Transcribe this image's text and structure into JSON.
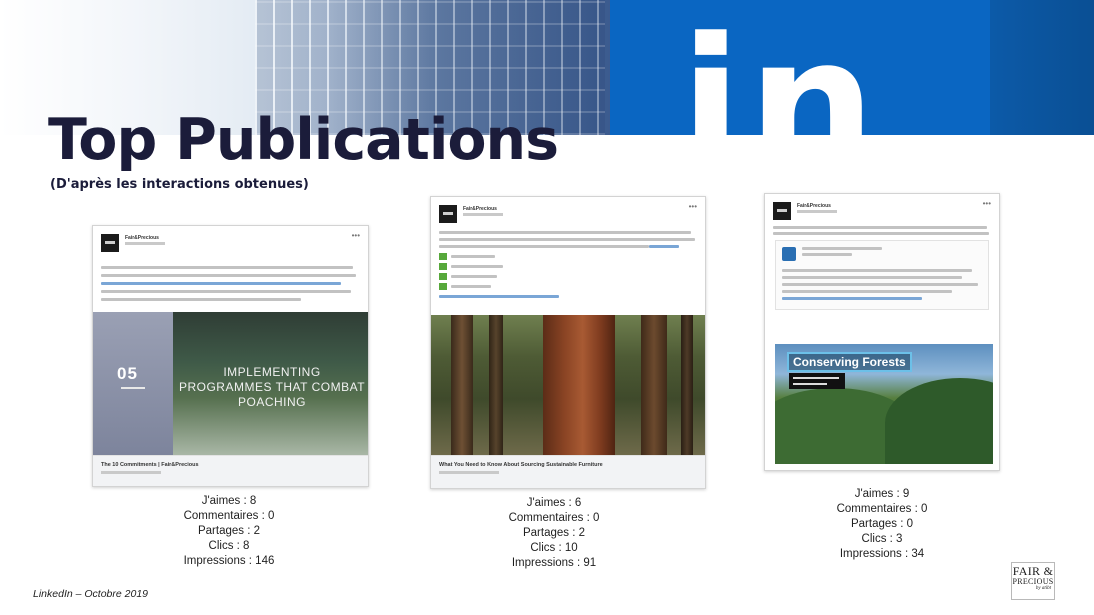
{
  "slide": {
    "title": "Top Publications",
    "subtitle": "(D'après les interactions obtenues)",
    "source": "LinkedIn – Octobre 2019",
    "brand_logo": {
      "line1": "FAIR &",
      "line2": "PRECIOUS",
      "line3": "by atibt"
    },
    "banner_logo": "in"
  },
  "posts": [
    {
      "author": "Fair&Precious",
      "photo_number": "05",
      "photo_overlay": "IMPLEMENTING PROGRAMMES THAT COMBAT POACHING",
      "footer_title": "The 10 Commitments | Fair&Precious",
      "stats": {
        "likes": "J'aimes : 8",
        "comments": "Commentaires : 0",
        "shares": "Partages : 2",
        "clicks": "Clics : 8",
        "impressions": "Impressions : 146"
      }
    },
    {
      "author": "Fair&Precious",
      "footer_title": "What You Need to Know About Sourcing Sustainable Furniture",
      "stats": {
        "likes": "J'aimes : 6",
        "comments": "Commentaires : 0",
        "shares": "Partages : 2",
        "clicks": "Clics : 10",
        "impressions": "Impressions : 91"
      }
    },
    {
      "author": "Fair&Precious",
      "photo_overlay": "Conserving Forests",
      "stats": {
        "likes": "J'aimes : 9",
        "comments": "Commentaires : 0",
        "shares": "Partages : 0",
        "clicks": "Clics : 3",
        "impressions": "Impressions : 34"
      }
    }
  ],
  "colors": {
    "title": "#1b1c3a",
    "linkedin_blue": "#0a66c2"
  }
}
